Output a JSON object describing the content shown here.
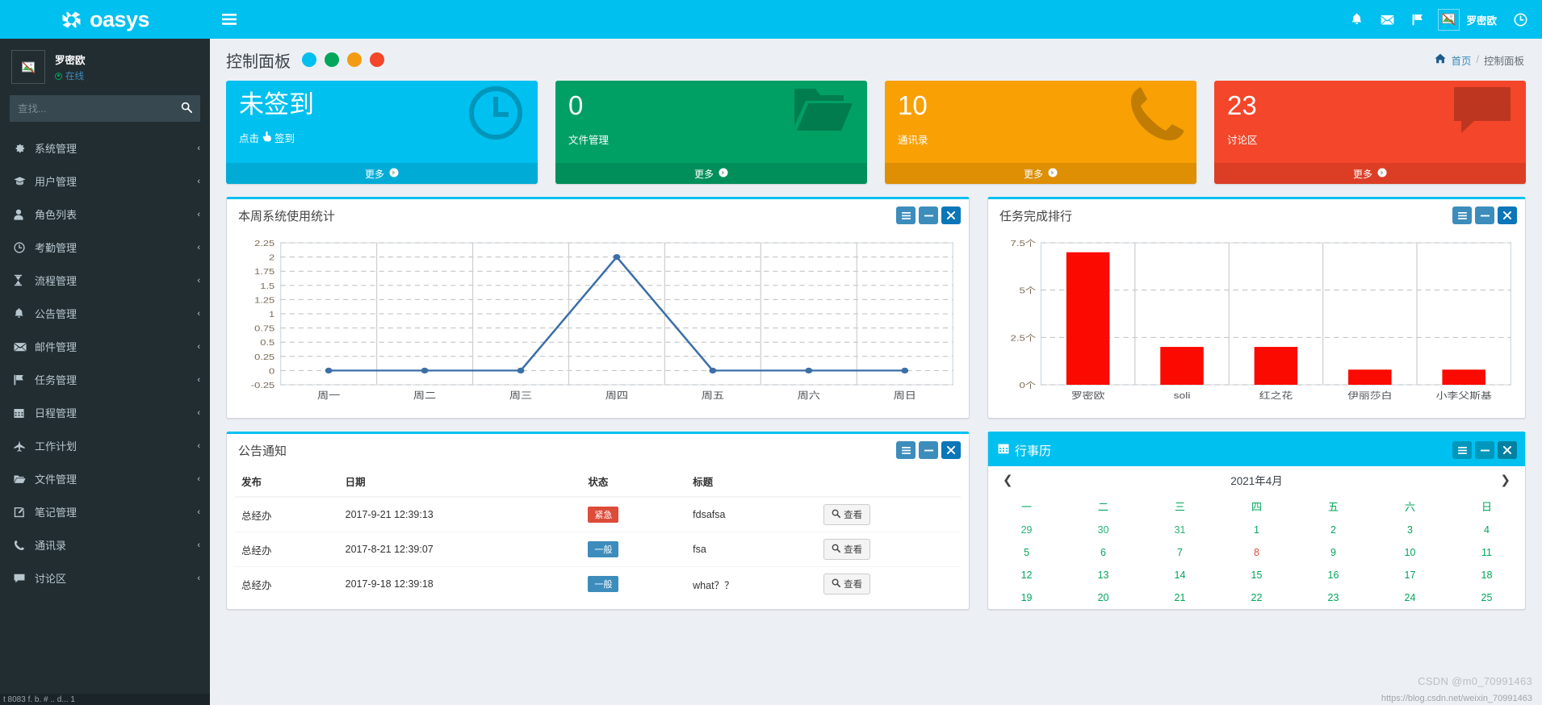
{
  "brand": {
    "name": "oasys",
    "logo_icon": "hexagon-logo-icon"
  },
  "sidebar": {
    "user": {
      "name": "罗密欧",
      "status": "在线",
      "avatar_icon": "broken-image-icon"
    },
    "search": {
      "placeholder": "查找...",
      "value": "",
      "icon": "search-icon"
    },
    "items": [
      {
        "label": "系统管理",
        "icon": "gear-icon",
        "arrow": "‹"
      },
      {
        "label": "用户管理",
        "icon": "graduation-cap-icon",
        "arrow": "‹"
      },
      {
        "label": "角色列表",
        "icon": "user-icon",
        "arrow": "‹"
      },
      {
        "label": "考勤管理",
        "icon": "clock-icon",
        "arrow": "‹"
      },
      {
        "label": "流程管理",
        "icon": "hourglass-icon",
        "arrow": "‹"
      },
      {
        "label": "公告管理",
        "icon": "bell-icon",
        "arrow": "‹"
      },
      {
        "label": "邮件管理",
        "icon": "envelope-icon",
        "arrow": "‹"
      },
      {
        "label": "任务管理",
        "icon": "flag-icon",
        "arrow": "‹"
      },
      {
        "label": "日程管理",
        "icon": "calendar-icon",
        "arrow": "‹"
      },
      {
        "label": "工作计划",
        "icon": "plane-icon",
        "arrow": "‹"
      },
      {
        "label": "文件管理",
        "icon": "folder-open-icon",
        "arrow": "‹"
      },
      {
        "label": "笔记管理",
        "icon": "edit-square-icon",
        "arrow": "‹"
      },
      {
        "label": "通讯录",
        "icon": "phone-icon",
        "arrow": "‹"
      },
      {
        "label": "讨论区",
        "icon": "comment-icon",
        "arrow": "‹"
      }
    ]
  },
  "topbar": {
    "menu_toggle_icon": "hamburger-icon",
    "icons": [
      "bell-icon",
      "envelope-icon",
      "flag-icon"
    ],
    "user_name": "罗密欧",
    "user_avatar_icon": "broken-image-icon",
    "right_icon": "clock-icon"
  },
  "content_header": {
    "page_title": "控制面板",
    "skin_dots": [
      "#00c0ef",
      "#00a65a",
      "#f39c12",
      "#f4462a"
    ],
    "breadcrumb": {
      "home_icon": "home-icon",
      "home": "首页",
      "sep": "/",
      "current": "控制面板"
    }
  },
  "info_boxes": [
    {
      "value": "未签到",
      "label_prefix": "点击",
      "label_suffix": "签到",
      "hand_icon": "hand-pointer-icon",
      "is_text_value": true,
      "footer": "更多",
      "footer_icon": "arrow-circle-right-icon",
      "bg": "#00c0ef",
      "icon": "clock-icon"
    },
    {
      "value": "0",
      "label": "文件管理",
      "is_text_value": false,
      "footer": "更多",
      "footer_icon": "arrow-circle-right-icon",
      "bg": "#00a065",
      "icon": "folder-icon"
    },
    {
      "value": "10",
      "label": "通讯录",
      "is_text_value": false,
      "footer": "更多",
      "footer_icon": "arrow-circle-right-icon",
      "bg": "#f8a004",
      "icon": "phone-icon"
    },
    {
      "value": "23",
      "label": "讨论区",
      "is_text_value": false,
      "footer": "更多",
      "footer_icon": "arrow-circle-right-icon",
      "bg": "#f4462a",
      "icon": "comment-icon"
    }
  ],
  "panels": {
    "line_panel": {
      "title": "本周系统使用统计",
      "tools": [
        "bars-icon",
        "minus-icon",
        "close-icon"
      ]
    },
    "bar_panel": {
      "title": "任务完成排行",
      "tools": [
        "bars-icon",
        "minus-icon",
        "close-icon"
      ]
    },
    "notice_panel": {
      "title": "公告通知",
      "tools": [
        "bars-icon",
        "minus-icon",
        "close-icon"
      ]
    },
    "calendar_panel": {
      "title": "行事历",
      "title_icon": "calendar-icon",
      "tools": [
        "bars-icon",
        "minus-icon",
        "close-icon"
      ]
    }
  },
  "chart_data": [
    {
      "type": "line",
      "title": "本周系统使用统计",
      "categories": [
        "周一",
        "周二",
        "周三",
        "周四",
        "周五",
        "周六",
        "周日"
      ],
      "values": [
        0,
        0,
        0,
        2,
        0,
        0,
        0
      ],
      "ytick_labels": [
        "2.25",
        "2",
        "1.75",
        "1.5",
        "1.25",
        "1",
        "0.75",
        "0.5",
        "0.25",
        "0",
        "-0.25"
      ],
      "yticks": [
        2.25,
        2,
        1.75,
        1.5,
        1.25,
        1,
        0.75,
        0.5,
        0.25,
        0,
        -0.25
      ],
      "ylim": [
        -0.25,
        2.25
      ],
      "xlabel": "",
      "ylabel": "",
      "grid": true,
      "legend": "none",
      "series_color": "#3b6fa8",
      "marker": "circle"
    },
    {
      "type": "bar",
      "title": "任务完成排行",
      "categories": [
        "罗密欧",
        "soli",
        "红之花",
        "伊丽莎白",
        "小李父斯基"
      ],
      "values": [
        7,
        2,
        2,
        0.8,
        0.8
      ],
      "ytick_labels": [
        "7.5个",
        "5个",
        "2.5个",
        "0个"
      ],
      "yticks": [
        7.5,
        5,
        2.5,
        0
      ],
      "ylim": [
        0,
        7.5
      ],
      "xlabel": "",
      "ylabel": "",
      "grid": true,
      "legend": "none",
      "bar_color": "#fa0a00"
    }
  ],
  "notice_table": {
    "headers": [
      "发布",
      "日期",
      "状态",
      "标题",
      ""
    ],
    "rows": [
      {
        "publisher": "总经办",
        "date": "2017-9-21 12:39:13",
        "status": "紧急",
        "status_type": "urgent",
        "title": "fdsafsa",
        "action": "查看",
        "action_icon": "search-icon"
      },
      {
        "publisher": "总经办",
        "date": "2017-8-21 12:39:07",
        "status": "一般",
        "status_type": "normal",
        "title": "fsa",
        "action": "查看",
        "action_icon": "search-icon"
      },
      {
        "publisher": "总经办",
        "date": "2017-9-18 12:39:18",
        "status": "一般",
        "status_type": "normal",
        "title": "what？？",
        "action": "查看",
        "action_icon": "search-icon"
      }
    ]
  },
  "calendar": {
    "month_label": "2021年4月",
    "prev_icon": "chevron-left-icon",
    "next_icon": "chevron-right-icon",
    "weekdays": [
      "一",
      "二",
      "三",
      "四",
      "五",
      "六",
      "日"
    ],
    "weeks": [
      [
        {
          "d": "29",
          "muted": true
        },
        {
          "d": "30",
          "muted": true
        },
        {
          "d": "31",
          "muted": true
        },
        {
          "d": "1"
        },
        {
          "d": "2"
        },
        {
          "d": "3"
        },
        {
          "d": "4"
        }
      ],
      [
        {
          "d": "5"
        },
        {
          "d": "6"
        },
        {
          "d": "7"
        },
        {
          "d": "8",
          "red": true
        },
        {
          "d": "9"
        },
        {
          "d": "10"
        },
        {
          "d": "11"
        }
      ],
      [
        {
          "d": "12"
        },
        {
          "d": "13"
        },
        {
          "d": "14"
        },
        {
          "d": "15"
        },
        {
          "d": "16"
        },
        {
          "d": "17"
        },
        {
          "d": "18"
        }
      ],
      [
        {
          "d": "19"
        },
        {
          "d": "20"
        },
        {
          "d": "21"
        },
        {
          "d": "22"
        },
        {
          "d": "23"
        },
        {
          "d": "24"
        },
        {
          "d": "25"
        }
      ]
    ]
  },
  "watermark": {
    "line1": "CSDN @m0_70991463",
    "line2": "https://blog.csdn.net/weixin_70991463"
  },
  "taskbar": {
    "text": "t 8083 f.  b.  # .. d... 1"
  }
}
